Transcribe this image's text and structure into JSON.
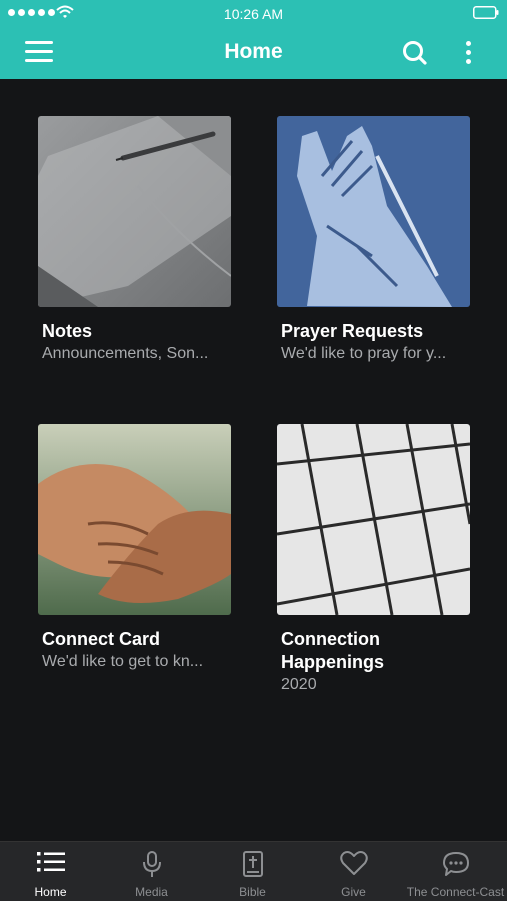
{
  "status_bar": {
    "time": "10:26 AM",
    "signal_icon": "signal-dots-icon",
    "wifi_icon": "wifi-icon",
    "battery_icon": "battery-icon"
  },
  "header": {
    "title": "Home",
    "menu_icon": "hamburger-icon",
    "search_icon": "search-icon",
    "more_icon": "more-vertical-icon"
  },
  "tiles": [
    {
      "title": "Notes",
      "subtitle": "Announcements, Son...",
      "image": "notebook-with-pen"
    },
    {
      "title": "Prayer Requests",
      "subtitle": "We'd like to pray for y...",
      "image": "praying-hands"
    },
    {
      "title": "Connect Card",
      "subtitle": "We'd like to get to kn...",
      "image": "handshake"
    },
    {
      "title": "Connection Happenings",
      "subtitle": "2020",
      "image": "calendar"
    }
  ],
  "tabbar": {
    "active": "Home",
    "tabs": [
      {
        "label": "Home",
        "icon": "list-icon"
      },
      {
        "label": "Media",
        "icon": "microphone-icon"
      },
      {
        "label": "Bible",
        "icon": "bible-icon"
      },
      {
        "label": "Give",
        "icon": "heart-icon"
      },
      {
        "label": "The Connect-Cast",
        "icon": "chat-bubble-icon"
      }
    ]
  },
  "colors": {
    "accent": "#2cc0b4",
    "background": "#141517",
    "tabbar": "#262729",
    "subtitle": "#a9abae"
  }
}
